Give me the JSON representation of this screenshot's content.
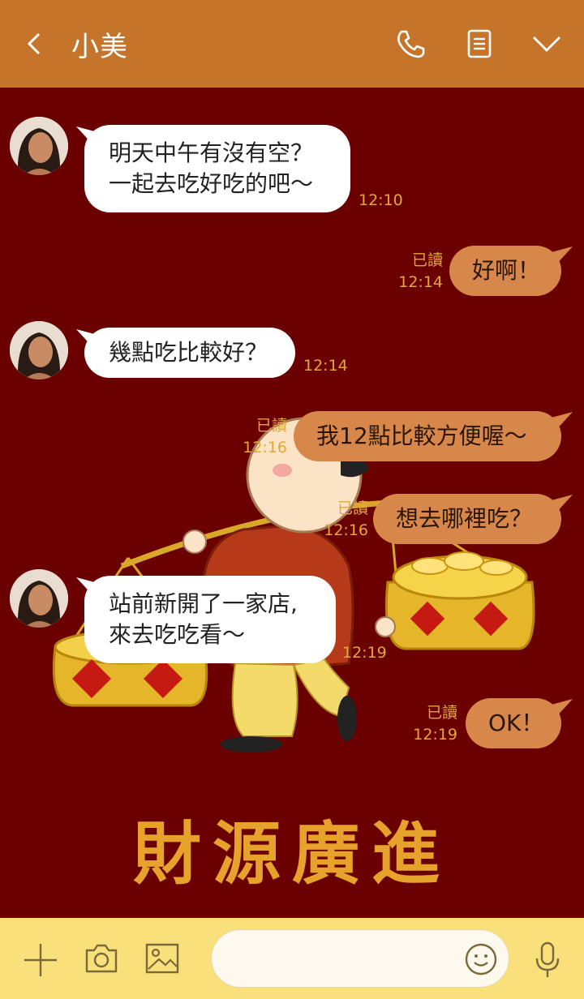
{
  "header": {
    "contact_name": "小美",
    "bg_color": "#c5742a",
    "icons": [
      "back-icon",
      "phone-icon",
      "notes-icon",
      "chevron-down-icon"
    ]
  },
  "chat": {
    "bg_color": "#6b0000",
    "motto": "財源廣進",
    "messages": [
      {
        "side": "in",
        "line1": "明天中午有沒有空？",
        "line2": "一起去吃好吃的吧～",
        "time": "12:10"
      },
      {
        "side": "out",
        "text": "好啊！",
        "read": "已讀",
        "time": "12:14"
      },
      {
        "side": "in",
        "text": "幾點吃比較好？",
        "time": "12:14"
      },
      {
        "side": "out",
        "text": "我12點比較方便喔～",
        "read": "已讀",
        "time": "12:16"
      },
      {
        "side": "out",
        "text": "想去哪裡吃？",
        "read": "已讀",
        "time": "12:16"
      },
      {
        "side": "in",
        "line1": "站前新開了一家店,",
        "line2": "來去吃吃看～",
        "time": "12:19"
      },
      {
        "side": "out",
        "text": "OK！",
        "read": "已讀",
        "time": "12:19"
      }
    ]
  },
  "footer": {
    "bg_color": "#f9e07a",
    "input_value": "",
    "icons": [
      "plus-icon",
      "camera-icon",
      "image-icon",
      "emoji-icon",
      "mic-icon"
    ]
  }
}
